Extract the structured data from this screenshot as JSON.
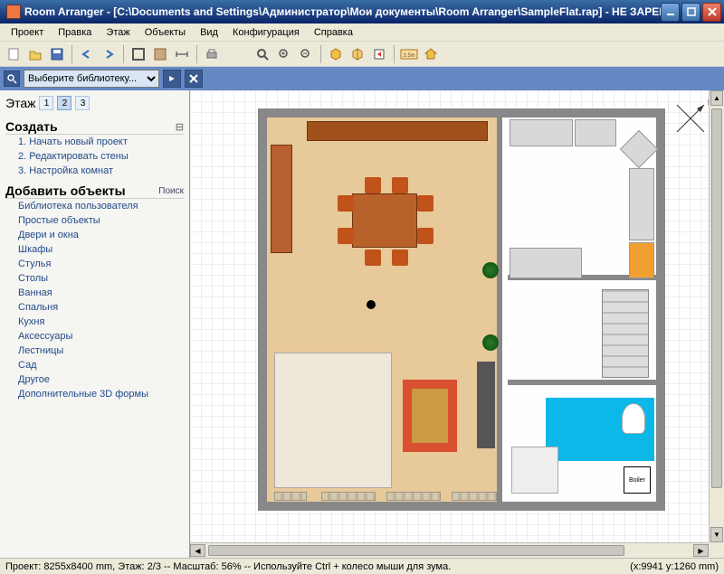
{
  "title": "Room Arranger - [C:\\Documents and Settings\\Администратор\\Мои документы\\Room Arranger\\SampleFlat.rap] - НЕ ЗАРЕГИСТРИРО...",
  "menu": [
    "Проект",
    "Правка",
    "Этаж",
    "Объекты",
    "Вид",
    "Конфигурация",
    "Справка"
  ],
  "search": {
    "placeholder": "Выберите библиотеку..."
  },
  "sidebar": {
    "floor_label": "Этаж",
    "floors": [
      "1",
      "2",
      "3"
    ],
    "active_floor": 1,
    "create": {
      "title": "Создать",
      "items": [
        "1. Начать новый проект",
        "2. Редактировать стены",
        "3. Настройка комнат"
      ]
    },
    "add": {
      "title": "Добавить объекты",
      "search_label": "Поиск",
      "items": [
        "Библиотека пользователя",
        "Простые объекты",
        "Двери и окна",
        "Шкафы",
        "Стулья",
        "Столы",
        "Ванная",
        "Спальня",
        "Кухня",
        "Аксессуары",
        "Лестницы",
        "Сад",
        "Другое",
        "Дополнительные 3D формы"
      ]
    }
  },
  "boiler_label": "Boiler",
  "status": {
    "left": "Проект: 8255x8400 mm, Этаж: 2/3 -- Масштаб: 56% -- Используйте Ctrl + колесо мыши для зума.",
    "right": "(x:9941 y:1260 mm)"
  }
}
